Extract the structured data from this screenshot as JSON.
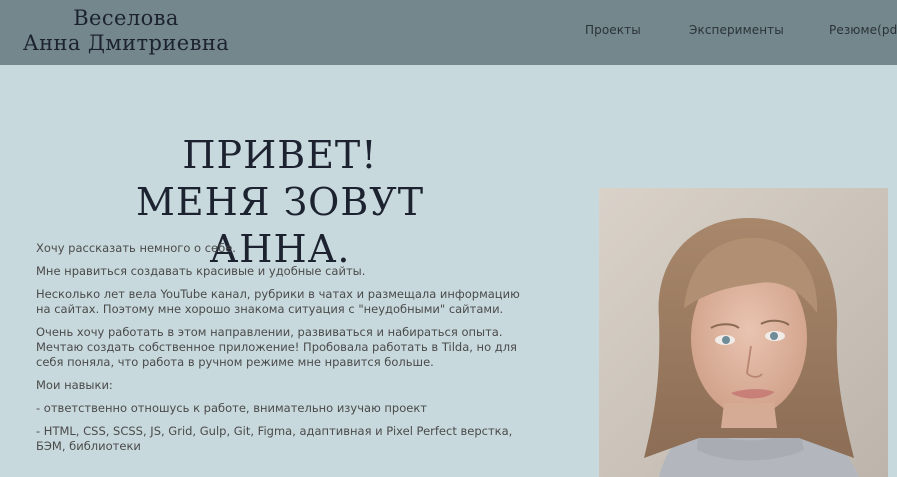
{
  "header": {
    "logo_line1": "Веселова",
    "logo_line2": "Анна Дмитриевна",
    "nav": [
      {
        "label": "Проекты"
      },
      {
        "label": "Эксперименты"
      },
      {
        "label": "Резюме(pdf"
      }
    ]
  },
  "hero": {
    "title_line1": "ПРИВЕТ!",
    "title_line2": "МЕНЯ ЗОВУТ АННА."
  },
  "about": {
    "paragraphs": [
      "Хочу рассказать немного о себе.",
      "Мне нравиться создавать красивые и удобные сайты.",
      "Несколько лет вела YouTube канал, рубрики в чатах и размещала информацию на сайтах. Поэтому мне хорошо знакома ситуация с \"неудобными\" сайтами.",
      "Очень хочу работать в этом направлении, развиваться и набираться опыта. Мечтаю создать собственное приложение! Пробовала работать в Tilda, но для себя поняла, что работа в ручном режиме мне нравится больше.",
      "Мои навыки:",
      "- ответственно отношусь к работе, внимательно изучаю проект",
      "- HTML, CSS, SCSS, JS, Grid, Gulp, Git, Figma, адаптивная и Pixel Perfect верстка, БЭМ, библиотеки"
    ]
  },
  "colors": {
    "header_bg": "#74878c",
    "page_bg": "#c8d9dd",
    "title": "#1c2230"
  },
  "photo": {
    "icon": "portrait-photo"
  }
}
